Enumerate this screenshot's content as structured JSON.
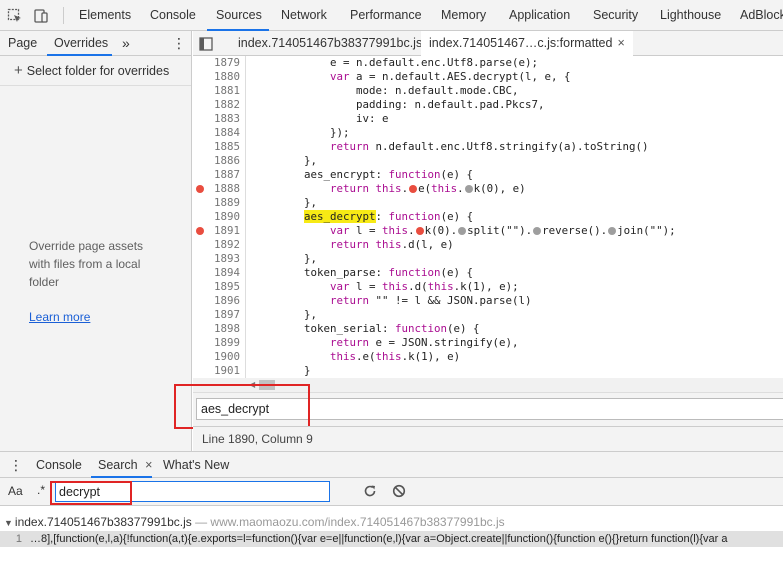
{
  "toolbar": {
    "icons": [
      "inspect-element-icon",
      "device-toolbar-icon"
    ],
    "tabs": [
      "Elements",
      "Console",
      "Sources",
      "Network",
      "Performance",
      "Memory",
      "Application",
      "Security",
      "Lighthouse",
      "AdBlock"
    ],
    "active_tab": "Sources"
  },
  "navigator": {
    "tabs": [
      "Page",
      "Overrides"
    ],
    "more": "»",
    "menu": "⋮",
    "active_tab": "Overrides",
    "add_folder": "Select folder for overrides",
    "message": "Override page assets with files from a local folder",
    "learn_more": "Learn more"
  },
  "editor": {
    "tabs": [
      {
        "label": "index.714051467b38377991bc.js"
      },
      {
        "label": "index.714051467…c.js:formatted",
        "close": "×"
      }
    ],
    "code_lines": [
      {
        "n": "1879",
        "bp": false,
        "html": "            e = n.default.enc.Utf8.parse(e);"
      },
      {
        "n": "1880",
        "bp": false,
        "html": "            <span class='kw'>var</span> a = n.default.AES.decrypt(l, e, {"
      },
      {
        "n": "1881",
        "bp": false,
        "html": "                mode: n.default.mode.CBC,"
      },
      {
        "n": "1882",
        "bp": false,
        "html": "                padding: n.default.pad.Pkcs7,"
      },
      {
        "n": "1883",
        "bp": false,
        "html": "                iv: e"
      },
      {
        "n": "1884",
        "bp": false,
        "html": "            });"
      },
      {
        "n": "1885",
        "bp": false,
        "html": "            <span class='kw'>return</span> n.default.enc.Utf8.stringify(a).toString()"
      },
      {
        "n": "1886",
        "bp": false,
        "html": "        },"
      },
      {
        "n": "1887",
        "bp": false,
        "html": "        aes_encrypt: <span class='kw'>function</span>(e) {"
      },
      {
        "n": "1888",
        "bp": true,
        "html": "            <span class='kw'>return</span> <span class='kw'>this</span>.<span class='inl-dot-r'></span>e(<span class='kw'>this</span>.<span class='inl-dot-g'></span>k(0), e)"
      },
      {
        "n": "1889",
        "bp": false,
        "html": "        },"
      },
      {
        "n": "1890",
        "bp": false,
        "html": "        <span class='hl'>aes_decrypt</span>: <span class='kw'>function</span>(e) {"
      },
      {
        "n": "1891",
        "bp": true,
        "html": "            <span class='kw'>var</span> l = <span class='kw'>this</span>.<span class='inl-dot-r'></span>k(0).<span class='inl-dot-g'></span>split(\"\").<span class='inl-dot-g'></span>reverse().<span class='inl-dot-g'></span>join(\"\");"
      },
      {
        "n": "1892",
        "bp": false,
        "html": "            <span class='kw'>return</span> <span class='kw'>this</span>.d(l, e)"
      },
      {
        "n": "1893",
        "bp": false,
        "html": "        },"
      },
      {
        "n": "1894",
        "bp": false,
        "html": "        token_parse: <span class='kw'>function</span>(e) {"
      },
      {
        "n": "1895",
        "bp": false,
        "html": "            <span class='kw'>var</span> l = <span class='kw'>this</span>.d(<span class='kw'>this</span>.k(1), e);"
      },
      {
        "n": "1896",
        "bp": false,
        "html": "            <span class='kw'>return</span> \"\" != l &amp;&amp; JSON.parse(l)"
      },
      {
        "n": "1897",
        "bp": false,
        "html": "        },"
      },
      {
        "n": "1898",
        "bp": false,
        "html": "        token_serial: <span class='kw'>function</span>(e) {"
      },
      {
        "n": "1899",
        "bp": false,
        "html": "            <span class='kw'>return</span> e = JSON.stringify(e),"
      },
      {
        "n": "1900",
        "bp": false,
        "html": "            <span class='kw'>this</span>.e(<span class='kw'>this</span>.k(1), e)"
      },
      {
        "n": "1901",
        "bp": false,
        "html": "        }"
      },
      {
        "n": "1902",
        "bp": false,
        "html": ""
      }
    ]
  },
  "find": {
    "value": "aes_decrypt"
  },
  "status": {
    "text": "Line 1890, Column 9"
  },
  "drawer": {
    "menu": "⋮",
    "tabs": [
      "Console",
      "Search",
      "What's New"
    ],
    "close": "×",
    "active_tab": "Search",
    "match_case": "Aa",
    "regex": ".*",
    "query": "decrypt",
    "refresh_icon": "refresh-icon",
    "clear_icon": "clear-icon"
  },
  "results": {
    "file": "index.714051467b38377991bc.js",
    "separator": " — ",
    "url": "www.maomaozu.com/index.714051467b38377991bc.js",
    "match_line_number": "1",
    "match_text": "…8],[function(e,l,a){!function(a,t){e.exports=l=function(){var e=e||function(e,l){var a=Object.create||function(){function e(){}return function(l){var a"
  }
}
